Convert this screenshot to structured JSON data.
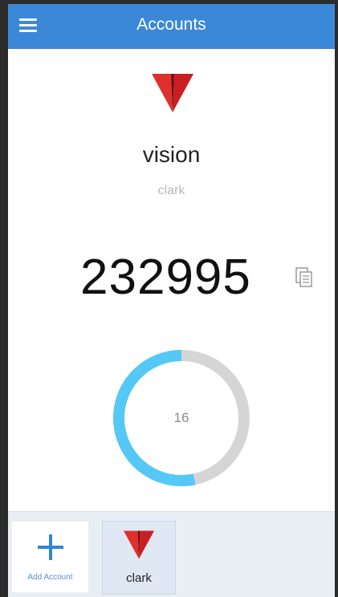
{
  "header": {
    "title": "Accounts",
    "menu_icon": "hamburger-menu-icon",
    "color": "#3b88d8"
  },
  "account": {
    "issuer": "vision",
    "name": "clark",
    "code": "232995",
    "logo_icon": "red-v-logo",
    "logo_color": "#d42a2a",
    "copy_icon": "copy-clipboard-icon"
  },
  "timer": {
    "seconds_remaining": "16",
    "period_seconds": 30,
    "progress_color": "#55c8f5",
    "track_color": "#d5d5d5"
  },
  "bottom_bar": {
    "add_account_label": "Add Account",
    "add_icon": "plus-icon",
    "tiles": [
      {
        "label": "clark",
        "icon": "red-v-logo"
      }
    ]
  }
}
